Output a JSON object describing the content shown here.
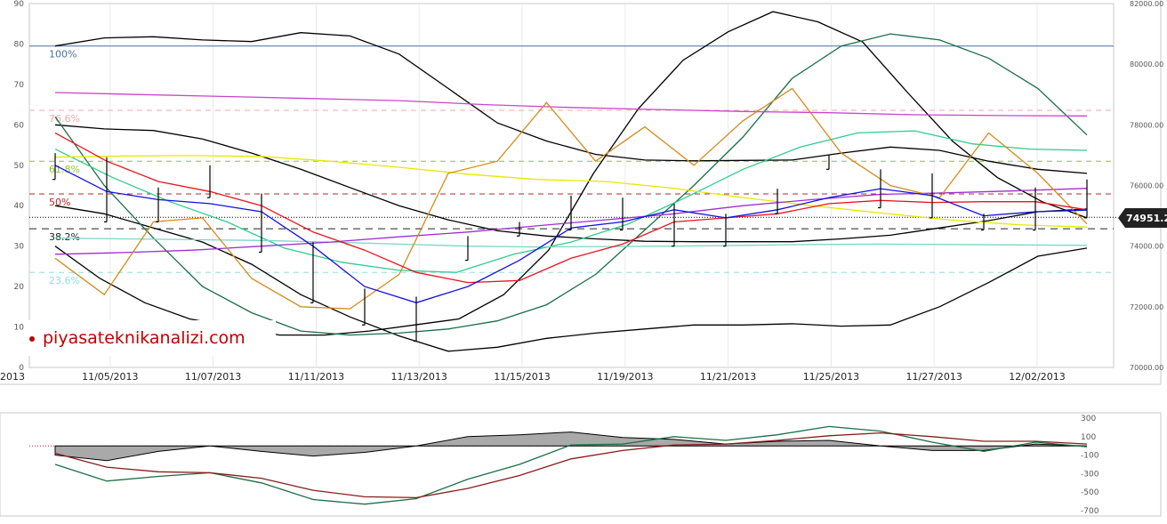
{
  "watermark": "piyasateknikanalizi.com",
  "price_badge": "74951.2",
  "chart_data": [
    {
      "type": "line",
      "panel": "main",
      "x_labels": [
        "2013",
        "11/05/2013",
        "11/07/2013",
        "11/11/2013",
        "11/13/2013",
        "11/15/2013",
        "11/19/2013",
        "11/21/2013",
        "11/25/2013",
        "11/27/2013",
        "12/02/2013"
      ],
      "left_axis": {
        "ylim": [
          0,
          90
        ],
        "ticks": [
          0,
          10,
          20,
          30,
          40,
          50,
          60,
          70,
          80,
          90
        ]
      },
      "right_axis": {
        "ylim": [
          70000,
          82000
        ],
        "ticks": [
          "70000.00",
          "72000.00",
          "74000.00",
          "76000.00",
          "78000.00",
          "80000.00",
          "82000.00"
        ]
      },
      "fib_levels": [
        {
          "label": "100%",
          "value": 79.5,
          "color": "#4a6fa0"
        },
        {
          "label": "76.6%",
          "value": 63.6,
          "color": "#f2a8a8"
        },
        {
          "label": "61.8%",
          "value": 51.0,
          "color": "#8fbf3f"
        },
        {
          "label": "50%",
          "value": 42.9,
          "color": "#b02a2a"
        },
        {
          "label": "38.2%",
          "value": 34.3,
          "color": "#222222"
        },
        {
          "label": "23.6%",
          "value": 23.5,
          "color": "#8ee0e0"
        }
      ],
      "last_price": 74951.2,
      "series": [
        {
          "color": "#000000",
          "values": [
            79.5,
            81.5,
            81.8,
            81,
            80.6,
            82.8,
            82,
            77.5,
            69,
            60.5,
            56,
            52.7,
            51.3,
            51.1,
            51.2,
            51.3,
            53,
            54.5,
            53.7,
            51,
            49,
            48
          ]
        },
        {
          "color": "#000000",
          "values": [
            60,
            59,
            58.6,
            56.5,
            53,
            49,
            44.5,
            40,
            36.5,
            33.8,
            32.5,
            31.8,
            31.2,
            31.1,
            31.1,
            31.1,
            31.8,
            32.7,
            34.5,
            36.3,
            38.5,
            39.2
          ]
        },
        {
          "color": "#000000",
          "values": [
            40,
            38,
            34.5,
            31,
            25.5,
            18,
            12.5,
            7.8,
            4,
            5,
            7.2,
            8.5,
            9.5,
            10.5,
            10.5,
            10.8,
            10.2,
            10.5,
            15,
            21,
            27.5,
            29.5
          ]
        },
        {
          "color": "#000000",
          "values": [
            30,
            22,
            16,
            12,
            10,
            8,
            8,
            9,
            10.5,
            12,
            18,
            29,
            48,
            64,
            76,
            83,
            88,
            85.5,
            80.5,
            68,
            56,
            47,
            41,
            37
          ]
        },
        {
          "color": "#1a6e46",
          "values": [
            62,
            45,
            32,
            20,
            13.5,
            9,
            8,
            8.5,
            9.5,
            11.5,
            15.5,
            23,
            34,
            45,
            57,
            71.5,
            79.5,
            82.5,
            81,
            76.5,
            69,
            57.5
          ]
        },
        {
          "color": "#2ecc8e",
          "values": [
            54,
            47,
            41,
            36,
            29.5,
            26,
            24,
            23.5,
            28,
            31,
            35.5,
            42,
            49,
            54.5,
            58,
            58.5,
            55.3,
            54,
            53.7
          ]
        },
        {
          "color": "#7bd6c6",
          "values": [
            32,
            31.8,
            31.6,
            31.4,
            31,
            30.5,
            30,
            29.8,
            29.9,
            30,
            30.2,
            30.4,
            30.5,
            30.4,
            30.3,
            30.2
          ]
        },
        {
          "color": "#e8e800",
          "values": [
            52,
            52.3,
            52.4,
            52.2,
            51,
            49.5,
            47.8,
            46.5,
            46,
            44.3,
            42,
            40,
            38.2,
            36.5,
            35.3,
            34.7
          ]
        },
        {
          "color": "#cc44cc",
          "values": [
            68,
            67.5,
            67,
            66.5,
            66,
            65,
            64.3,
            63.8,
            63.3,
            63,
            62.5,
            62.3,
            62.2
          ]
        },
        {
          "color": "#9c2fd0",
          "values": [
            28,
            28.4,
            29,
            30,
            31,
            32.3,
            33.5,
            35,
            36.5,
            38,
            40,
            41.5,
            42.8,
            43.2,
            43.7,
            44.3
          ]
        },
        {
          "color": "#d48a1c",
          "values": [
            27,
            18,
            36,
            37,
            22,
            15,
            14.5,
            23,
            48,
            51,
            65.5,
            51,
            59.5,
            50,
            61,
            69,
            53,
            45,
            42,
            58,
            48,
            35.5
          ]
        },
        {
          "color": "#e8141e",
          "values": [
            58,
            51,
            46,
            43.5,
            40,
            33.5,
            29,
            23.5,
            21,
            21.5,
            27,
            30.5,
            36,
            37,
            38,
            40.5,
            41.3,
            40.8,
            41,
            41,
            39
          ]
        },
        {
          "color": "#1010e0",
          "values": [
            50,
            43.5,
            41.5,
            40.5,
            38.5,
            30,
            20,
            16,
            20,
            26.5,
            34.5,
            36,
            39,
            37,
            39,
            42,
            44.2,
            42.5,
            37.5,
            38.5,
            38.9
          ]
        }
      ],
      "bars": [
        {
          "x_index": 0,
          "high": 53,
          "low": 46.5
        },
        {
          "x_index": 1,
          "high": 52,
          "low": 36
        },
        {
          "x_index": 2,
          "high": 44.5,
          "low": 36
        },
        {
          "x_index": 3,
          "high": 50,
          "low": 42
        },
        {
          "x_index": 4,
          "high": 43,
          "low": 28.5
        },
        {
          "x_index": 5,
          "high": 31,
          "low": 16
        },
        {
          "x_index": 6,
          "high": 19.5,
          "low": 10.5
        },
        {
          "x_index": 7,
          "high": 17.5,
          "low": 6.5
        },
        {
          "x_index": 8,
          "high": 32.5,
          "low": 26.5
        },
        {
          "x_index": 9,
          "high": 36,
          "low": 32.5
        },
        {
          "x_index": 10,
          "high": 42.5,
          "low": 34
        },
        {
          "x_index": 11,
          "high": 42,
          "low": 34
        },
        {
          "x_index": 12,
          "high": 40.5,
          "low": 30
        },
        {
          "x_index": 13,
          "high": 38,
          "low": 30
        },
        {
          "x_index": 14,
          "high": 44.2,
          "low": 38
        },
        {
          "x_index": 15,
          "high": 52.5,
          "low": 49
        },
        {
          "x_index": 16,
          "high": 49,
          "low": 39.5
        },
        {
          "x_index": 17,
          "high": 48,
          "low": 37
        },
        {
          "x_index": 18,
          "high": 38,
          "low": 34
        },
        {
          "x_index": 19,
          "high": 44.5,
          "low": 34
        },
        {
          "x_index": 20,
          "high": 46.5,
          "low": 37
        }
      ]
    },
    {
      "type": "line",
      "panel": "oscillator",
      "ylim": [
        -700,
        300
      ],
      "ticks": [
        300,
        100,
        -100,
        -300,
        -500,
        -700
      ],
      "histogram": [
        -100,
        -160,
        -60,
        0,
        -60,
        -110,
        -70,
        0,
        100,
        120,
        150,
        90,
        70,
        20,
        50,
        60,
        0,
        -50,
        -50,
        20,
        0
      ],
      "series": [
        {
          "color": "#1a6e46",
          "values": [
            -200,
            -380,
            -330,
            -290,
            -400,
            -580,
            -630,
            -570,
            -360,
            -200,
            10,
            20,
            100,
            60,
            120,
            210,
            160,
            40,
            -60,
            40,
            -10
          ]
        },
        {
          "color": "#8b1a1a",
          "values": [
            -80,
            -230,
            -280,
            -290,
            -350,
            -480,
            -550,
            -560,
            -460,
            -320,
            -140,
            -50,
            10,
            20,
            60,
            110,
            140,
            100,
            50,
            50,
            20
          ]
        }
      ]
    }
  ]
}
